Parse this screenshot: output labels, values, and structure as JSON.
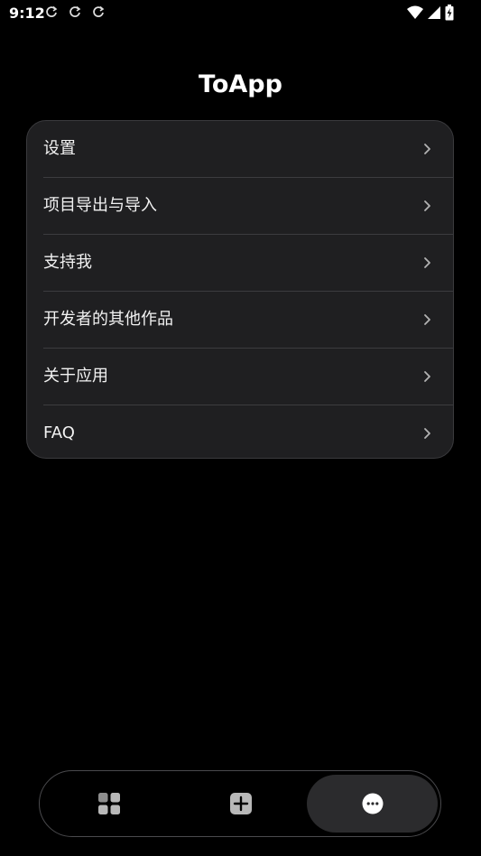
{
  "status_bar": {
    "time": "9:12",
    "icons": [
      "sync-icon",
      "sync-icon",
      "sync-icon",
      "wifi-icon",
      "cell-signal-icon",
      "battery-charging-icon"
    ]
  },
  "header": {
    "title": "ToApp"
  },
  "menu": {
    "items": [
      {
        "label": "设置",
        "icon": "chevron-right-icon"
      },
      {
        "label": "项目导出与导入",
        "icon": "chevron-right-icon"
      },
      {
        "label": "支持我",
        "icon": "chevron-right-icon"
      },
      {
        "label": "开发者的其他作品",
        "icon": "chevron-right-icon"
      },
      {
        "label": "关于应用",
        "icon": "chevron-right-icon"
      },
      {
        "label": "FAQ",
        "icon": "chevron-right-icon"
      }
    ]
  },
  "bottom_nav": {
    "items": [
      {
        "icon": "apps-grid-icon",
        "active": false
      },
      {
        "icon": "add-square-icon",
        "active": false
      },
      {
        "icon": "more-chat-icon",
        "active": true
      }
    ]
  },
  "colors": {
    "background": "#000000",
    "card": "#1f1f21",
    "divider": "#3c3c3f",
    "text": "#f2f2f2",
    "icon_grey": "#b3b3b3"
  }
}
